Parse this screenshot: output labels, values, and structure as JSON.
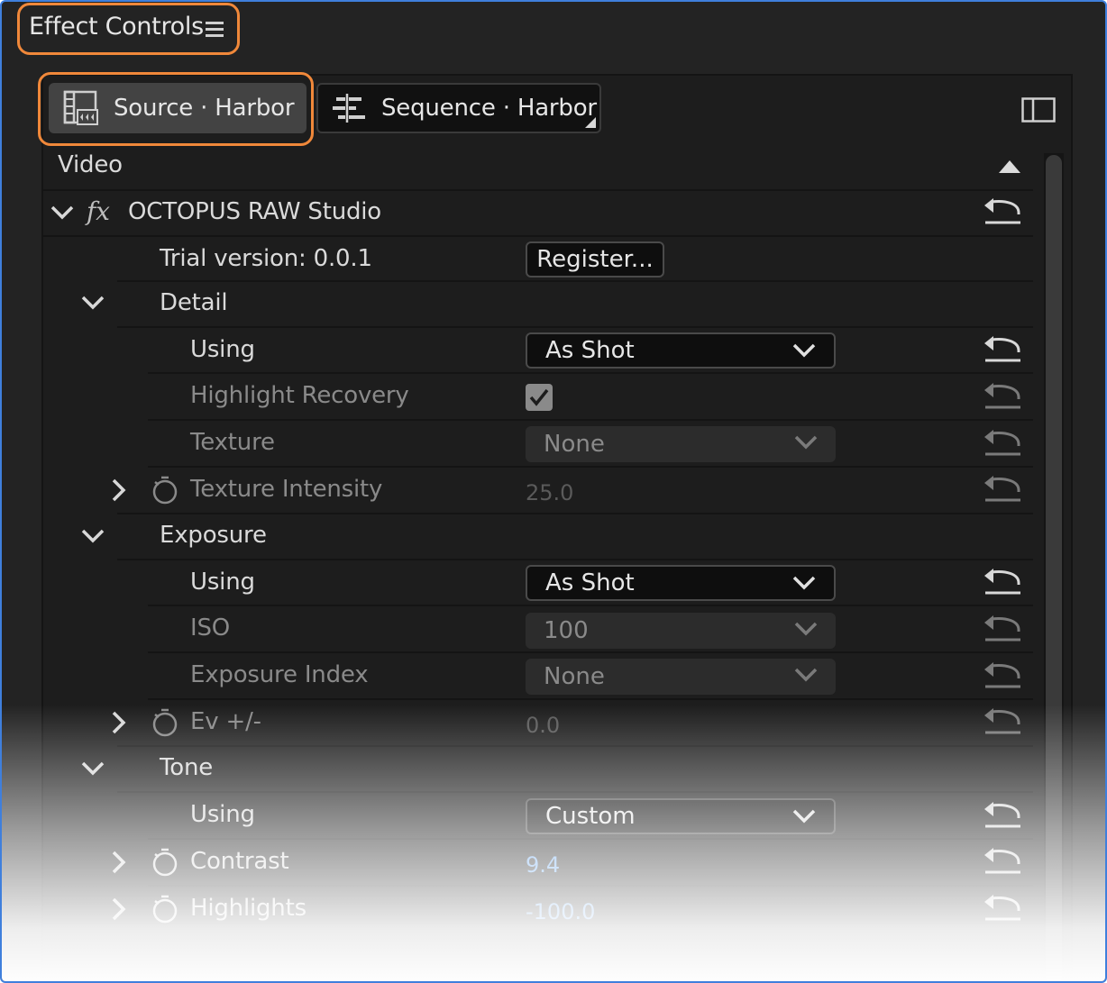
{
  "panel": {
    "title": "Effect Controls",
    "menu_icon": "hamburger-menu-icon"
  },
  "tabs": [
    {
      "label": "Source · Harbor",
      "icon": "source-clip-icon",
      "selected": true
    },
    {
      "label": "Sequence · Harbor",
      "icon": "sequence-icon",
      "selected": false
    }
  ],
  "section": {
    "label": "Video"
  },
  "effect": {
    "name": "OCTOPUS RAW Studio",
    "fx_label": "fx",
    "trial_label": "Trial version: 0.0.1",
    "register_label": "Register..."
  },
  "groups": {
    "detail": {
      "label": "Detail",
      "using": {
        "label": "Using",
        "value": "As Shot"
      },
      "highlight_recovery": {
        "label": "Highlight Recovery",
        "checked": true
      },
      "texture": {
        "label": "Texture",
        "value": "None"
      },
      "texture_intensity": {
        "label": "Texture Intensity",
        "value": "25.0"
      }
    },
    "exposure": {
      "label": "Exposure",
      "using": {
        "label": "Using",
        "value": "As Shot"
      },
      "iso": {
        "label": "ISO",
        "value": "100"
      },
      "exposure_index": {
        "label": "Exposure Index",
        "value": "None"
      },
      "ev": {
        "label": "Ev +/-",
        "value": "0.0"
      }
    },
    "tone": {
      "label": "Tone",
      "using": {
        "label": "Using",
        "value": "Custom"
      },
      "contrast": {
        "label": "Contrast",
        "value": "9.4"
      },
      "highlights": {
        "label": "Highlights",
        "value": "-100.0"
      }
    }
  },
  "colors": {
    "highlight_outline": "#f0883a",
    "value_blue": "#6aa8f0"
  }
}
